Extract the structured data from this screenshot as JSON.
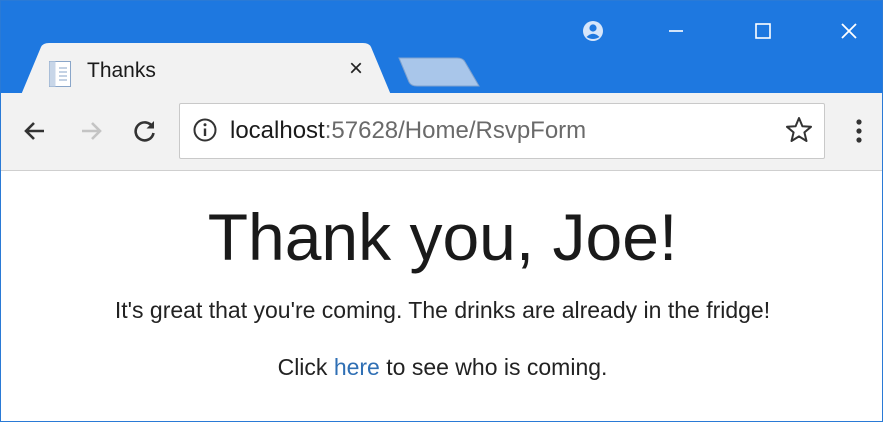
{
  "window": {
    "controls": {
      "account_icon": "account-circle-icon",
      "minimize_icon": "minimize-icon",
      "maximize_icon": "maximize-icon",
      "close_icon": "close-icon"
    },
    "colors": {
      "titlebar": "#1e78e0",
      "tab_bg": "#f2f2f2",
      "link": "#2f6fb4"
    }
  },
  "tab": {
    "title": "Thanks",
    "close_label": "×",
    "icon": "page-icon"
  },
  "toolbar": {
    "back_icon": "back-arrow-icon",
    "forward_icon": "forward-arrow-icon",
    "reload_icon": "reload-icon",
    "url_host": "localhost",
    "url_rest": ":57628/Home/RsvpForm",
    "star_icon": "star-icon",
    "menu_icon": "more-vert-icon"
  },
  "page": {
    "heading": "Thank you, Joe!",
    "message": "It's great that you're coming. The drinks are already in the fridge!",
    "click_prefix": "Click ",
    "link_text": "here",
    "click_suffix": " to see who is coming."
  }
}
